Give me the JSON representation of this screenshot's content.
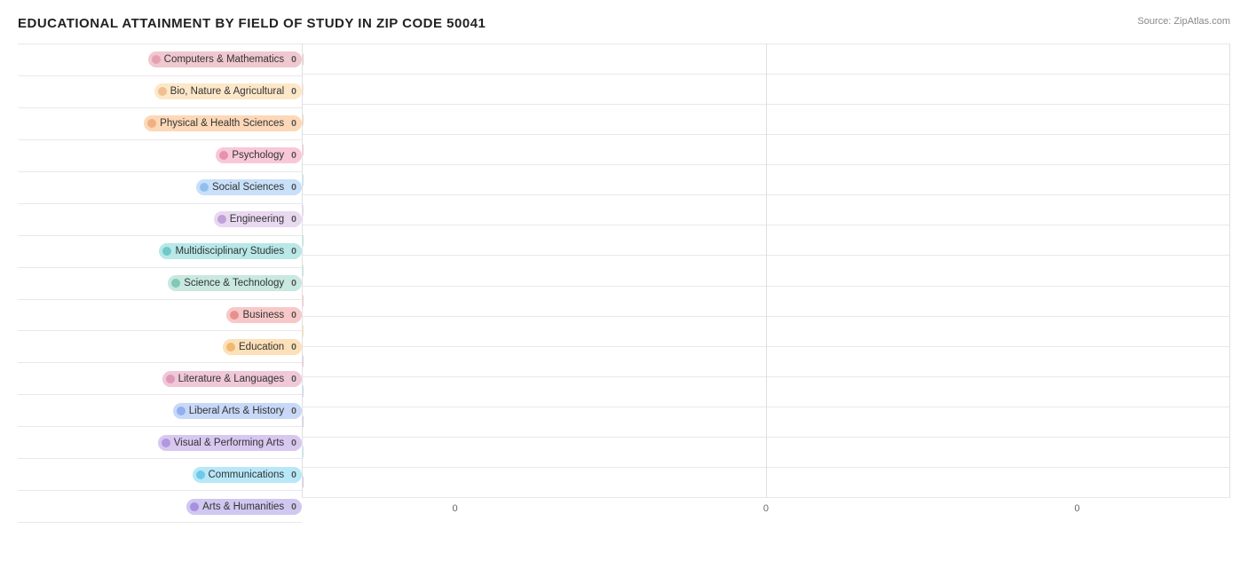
{
  "title": "EDUCATIONAL ATTAINMENT BY FIELD OF STUDY IN ZIP CODE 50041",
  "source": "Source: ZipAtlas.com",
  "categories": [
    {
      "label": "Computers & Mathematics",
      "value": 0,
      "pillColor": "#f0c8d0",
      "dotColor": "#e8a0b0",
      "barColor": "#f0c8d0"
    },
    {
      "label": "Bio, Nature & Agricultural",
      "value": 0,
      "pillColor": "#fce8c8",
      "dotColor": "#f0c090",
      "barColor": "#fce8c8"
    },
    {
      "label": "Physical & Health Sciences",
      "value": 0,
      "pillColor": "#fcd8b8",
      "dotColor": "#f0b080",
      "barColor": "#fcd8b8"
    },
    {
      "label": "Psychology",
      "value": 0,
      "pillColor": "#f8c8d8",
      "dotColor": "#e890b0",
      "barColor": "#f8c8d8"
    },
    {
      "label": "Social Sciences",
      "value": 0,
      "pillColor": "#c8e0f8",
      "dotColor": "#90c0f0",
      "barColor": "#c8e0f8"
    },
    {
      "label": "Engineering",
      "value": 0,
      "pillColor": "#e8d8f0",
      "dotColor": "#c0a0d8",
      "barColor": "#e8d8f0"
    },
    {
      "label": "Multidisciplinary Studies",
      "value": 0,
      "pillColor": "#b8e8e8",
      "dotColor": "#70c8c8",
      "barColor": "#b8e8e8"
    },
    {
      "label": "Science & Technology",
      "value": 0,
      "pillColor": "#c8e8e0",
      "dotColor": "#80c8b8",
      "barColor": "#c8e8e0"
    },
    {
      "label": "Business",
      "value": 0,
      "pillColor": "#f8c8c8",
      "dotColor": "#e89090",
      "barColor": "#f8c8c8"
    },
    {
      "label": "Education",
      "value": 0,
      "pillColor": "#fce0b8",
      "dotColor": "#f0b870",
      "barColor": "#fce0b8"
    },
    {
      "label": "Literature & Languages",
      "value": 0,
      "pillColor": "#f0c8d8",
      "dotColor": "#e098b8",
      "barColor": "#f0c8d8"
    },
    {
      "label": "Liberal Arts & History",
      "value": 0,
      "pillColor": "#c8d8f8",
      "dotColor": "#90b0f0",
      "barColor": "#c8d8f8"
    },
    {
      "label": "Visual & Performing Arts",
      "value": 0,
      "pillColor": "#d8c8f0",
      "dotColor": "#b098e0",
      "barColor": "#d8c8f0"
    },
    {
      "label": "Communications",
      "value": 0,
      "pillColor": "#b8e8f8",
      "dotColor": "#70c8e8",
      "barColor": "#b8e8f8"
    },
    {
      "label": "Arts & Humanities",
      "value": 0,
      "pillColor": "#d0c8f0",
      "dotColor": "#a890e0",
      "barColor": "#d0c8f0"
    }
  ],
  "xAxisLabels": [
    "0",
    "0",
    "0"
  ]
}
